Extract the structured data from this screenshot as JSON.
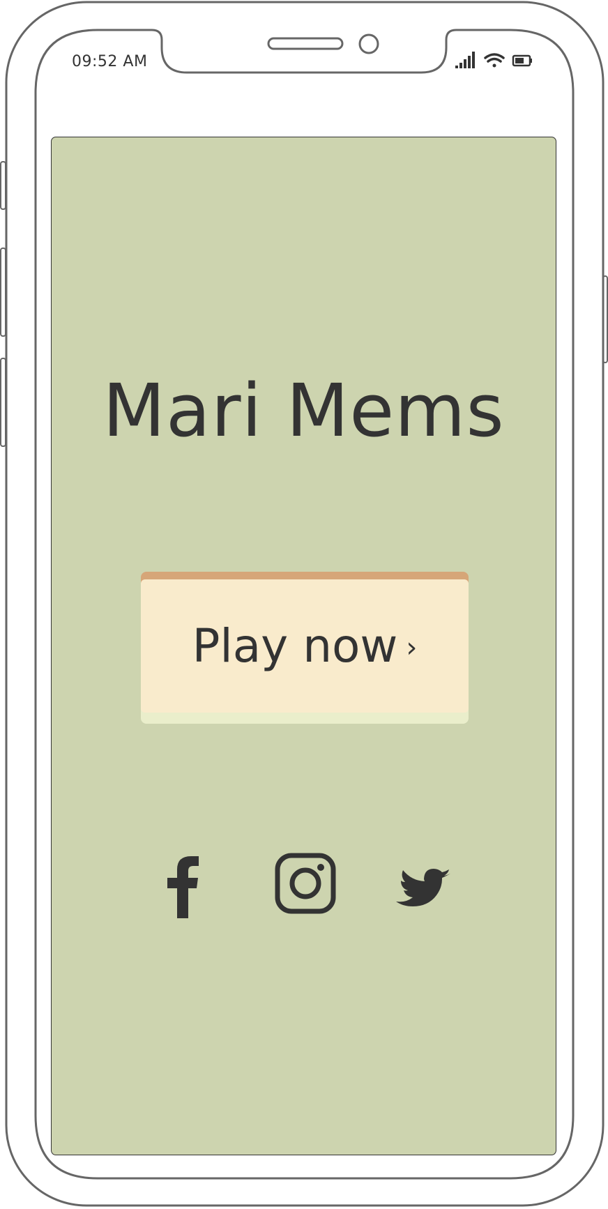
{
  "status_bar": {
    "time": "09:52 AM",
    "icons": [
      "signal-icon",
      "wifi-icon",
      "battery-icon"
    ]
  },
  "app": {
    "title": "Mari Mems",
    "play_button": {
      "label": "Play now",
      "chevron": "›"
    },
    "socials": [
      {
        "name": "facebook-icon"
      },
      {
        "name": "instagram-icon"
      },
      {
        "name": "twitter-icon"
      }
    ]
  },
  "colors": {
    "screen_background": "#cdd4af",
    "button_face": "#f9ebcc",
    "button_top_edge": "#d6a678",
    "button_bottom_edge": "#eaeecb",
    "ink": "#333333",
    "frame": "#666666"
  }
}
